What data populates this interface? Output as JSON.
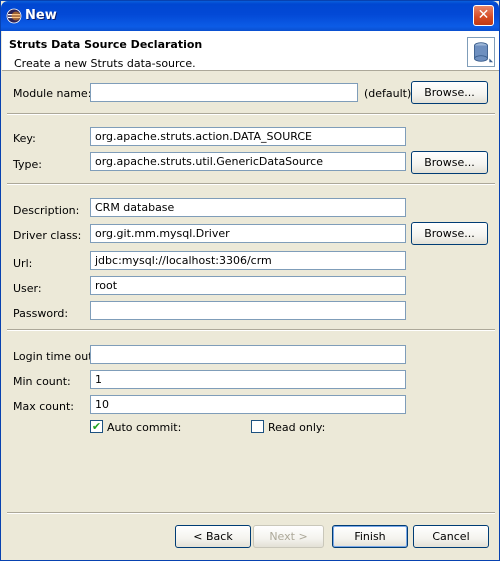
{
  "window": {
    "title": "New"
  },
  "header": {
    "title": "Struts Data Source Declaration",
    "subtitle": "Create a new Struts data-source."
  },
  "form": {
    "module_name": {
      "label": "Module name:",
      "value": "",
      "suffix": "(default)",
      "browse": "Browse..."
    },
    "key": {
      "label": "Key:",
      "value": "org.apache.struts.action.DATA_SOURCE"
    },
    "type": {
      "label": "Type:",
      "value": "org.apache.struts.util.GenericDataSource",
      "browse": "Browse..."
    },
    "description": {
      "label": "Description:",
      "value": "CRM database"
    },
    "driver_class": {
      "label": "Driver class:",
      "value": "org.git.mm.mysql.Driver",
      "browse": "Browse..."
    },
    "url": {
      "label": "Url:",
      "value": "jdbc:mysql://localhost:3306/crm"
    },
    "user": {
      "label": "User:",
      "value": "root"
    },
    "password": {
      "label": "Password:",
      "value": ""
    },
    "login_timeout": {
      "label": "Login time out:",
      "value": ""
    },
    "min_count": {
      "label": "Min count:",
      "value": "1"
    },
    "max_count": {
      "label": "Max count:",
      "value": "10"
    },
    "auto_commit": {
      "label": "Auto commit:",
      "checked": true
    },
    "read_only": {
      "label": "Read only:",
      "checked": false
    }
  },
  "buttons": {
    "back": "< Back",
    "next": "Next >",
    "finish": "Finish",
    "cancel": "Cancel"
  },
  "icons": {
    "app": "eclipse-icon",
    "close": "close-icon",
    "banner": "database-icon",
    "check": "checkmark-icon"
  },
  "colors": {
    "titlebar": "#0349d6",
    "dialog_bg": "#ece9d8",
    "field_border": "#7f9db9"
  }
}
